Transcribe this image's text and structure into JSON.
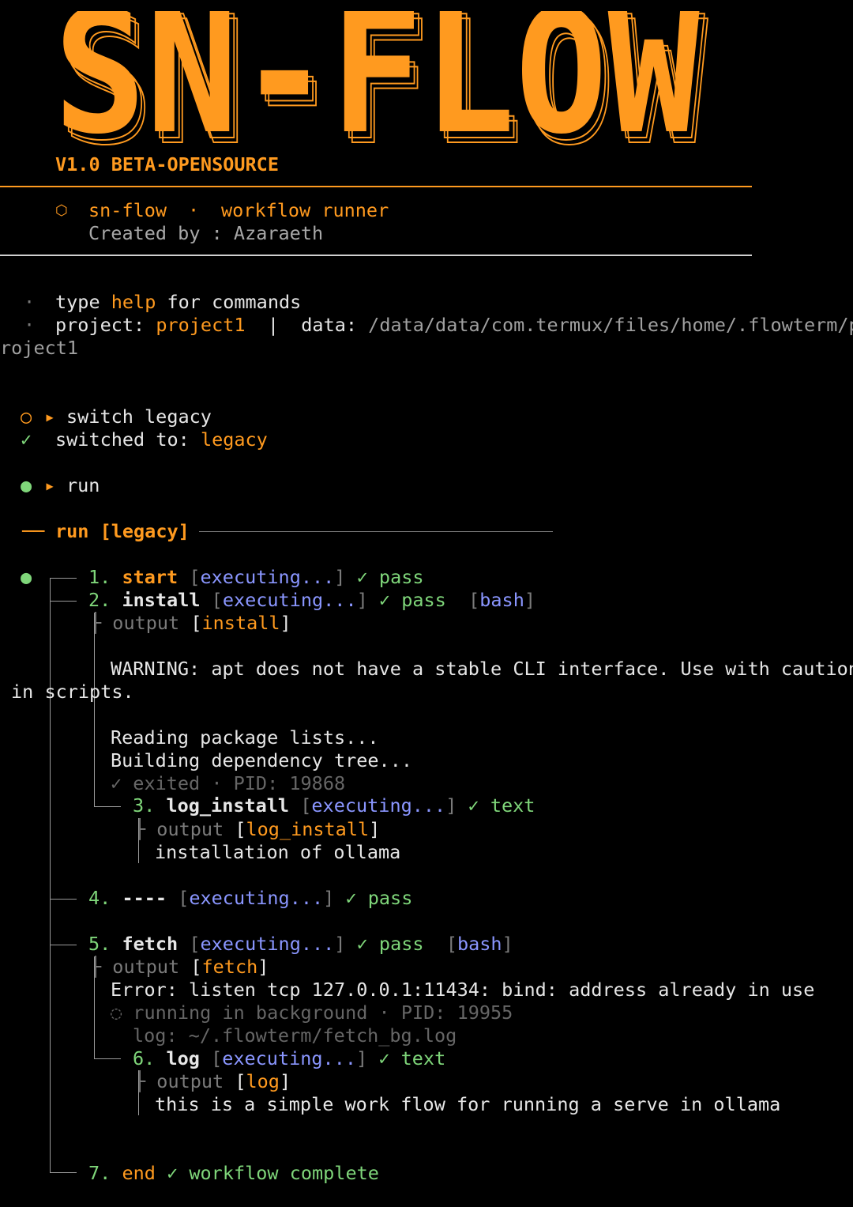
{
  "banner": {
    "logo_text": "SN-FLOW",
    "version": "V1.0 BETA-OPENSOURCE",
    "accent_color": "#ff9a1f"
  },
  "info": {
    "icon": "hexagon-icon",
    "app_name": "sn-flow",
    "separator": "·",
    "subtitle": "workflow runner",
    "created_by": "Created by : Azaraeth"
  },
  "hints": {
    "bullet": "·",
    "line1_pre": "type ",
    "line1_cmd": "help",
    "line1_post": " for commands",
    "project_label": "project: ",
    "project_name": "project1",
    "pipe": "|",
    "data_label": "data: ",
    "data_path_1": "/data/data/com.termux/files/home/.flowterm/p",
    "data_path_2": "roject1"
  },
  "commands": [
    {
      "status_glyph": "○",
      "prompt_glyph": "▸",
      "text": "switch legacy"
    },
    {
      "status_glyph": "●",
      "prompt_glyph": "▸",
      "text": "run"
    }
  ],
  "switch_result": {
    "check": "✓",
    "label": "switched to: ",
    "value": "legacy"
  },
  "run_header": {
    "dash": "──",
    "title": "run [legacy]"
  },
  "tags": {
    "executing": "executing...",
    "bash": "bash",
    "output": "output"
  },
  "steps": [
    {
      "num": "1.",
      "name": "start",
      "result": "pass"
    },
    {
      "num": "2.",
      "name": "install",
      "result": "pass",
      "type": "bash",
      "output_name": "install",
      "lines": [
        "WARNING: apt does not have a stable CLI interface. Use with caution",
        "in scripts.",
        "Reading package lists...",
        "Building dependency tree..."
      ],
      "exit_note": "✓ exited · PID: 19868"
    },
    {
      "num": "3.",
      "name": "log_install",
      "result": "text",
      "output_name": "log_install",
      "lines": [
        "installation of ollama"
      ]
    },
    {
      "num": "4.",
      "name": "----",
      "result": "pass"
    },
    {
      "num": "5.",
      "name": "fetch",
      "result": "pass",
      "type": "bash",
      "output_name": "fetch",
      "lines": [
        "Error: listen tcp 127.0.0.1:11434: bind: address already in use"
      ],
      "bg_note": "◌ running in background · PID: 19955",
      "log_note": "log: ~/.flowterm/fetch_bg.log"
    },
    {
      "num": "6.",
      "name": "log",
      "result": "text",
      "output_name": "log",
      "lines": [
        "this is a simple work flow for running a serve in ollama"
      ]
    },
    {
      "num": "7.",
      "name": "end",
      "result": "workflow complete"
    }
  ]
}
